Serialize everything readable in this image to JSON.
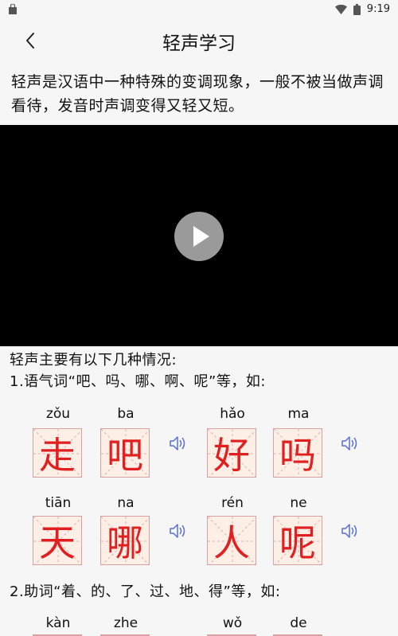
{
  "status": {
    "time": "9:19"
  },
  "app_bar": {
    "title": "轻声学习",
    "back_icon": "chevron-left-icon"
  },
  "intro": {
    "text": "轻声是汉语中一种特殊的变调现象，一般不被当做声调看待，发音时声调变得又轻又短。"
  },
  "video": {
    "play_icon": "play-icon",
    "background": "#000000"
  },
  "sections": [
    {
      "heading_1": "轻声主要有以下几种情况:",
      "heading_2": "1.语气词“吧、吗、哪、啊、呢”等，如:"
    },
    {
      "heading_1": "2.助词“着、的、了、过、地、得”等，如:"
    }
  ],
  "word_groups": [
    {
      "chars": [
        {
          "pinyin": "zǒu",
          "char": "走"
        },
        {
          "pinyin": "ba",
          "char": "吧"
        }
      ]
    },
    {
      "chars": [
        {
          "pinyin": "hǎo",
          "char": "好"
        },
        {
          "pinyin": "ma",
          "char": "吗"
        }
      ]
    },
    {
      "chars": [
        {
          "pinyin": "tiān",
          "char": "天"
        },
        {
          "pinyin": "na",
          "char": "哪"
        }
      ]
    },
    {
      "chars": [
        {
          "pinyin": "rén",
          "char": "人"
        },
        {
          "pinyin": "ne",
          "char": "呢"
        }
      ]
    }
  ],
  "partial_row": [
    {
      "pinyin": "kàn"
    },
    {
      "pinyin": "zhe"
    },
    {
      "pinyin": "wǒ"
    },
    {
      "pinyin": "de"
    }
  ],
  "colors": {
    "char_red": "#e02020",
    "cell_bg": "#fdeee6",
    "speaker": "#5a6fd0"
  },
  "icons": {
    "speaker": "speaker-icon"
  }
}
